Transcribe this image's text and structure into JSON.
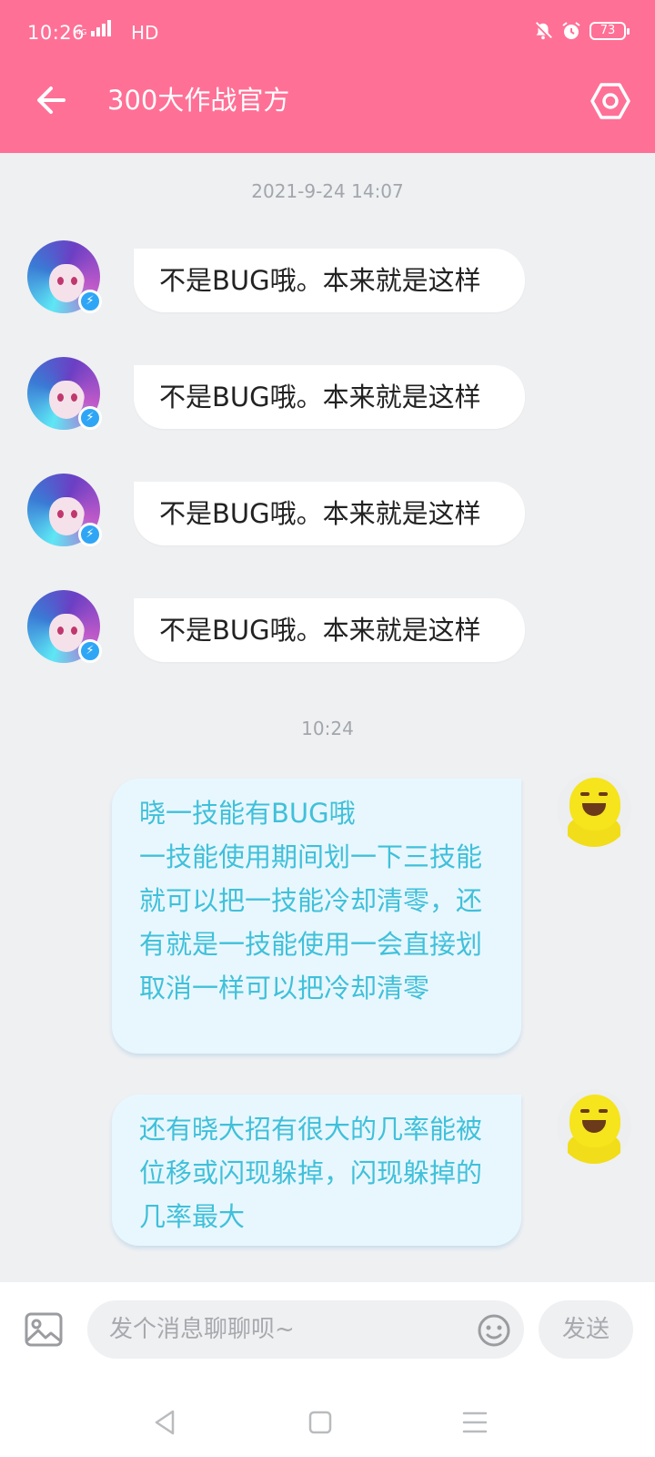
{
  "status_bar": {
    "time": "10:26",
    "network": "4G",
    "hd": "HD",
    "battery": "73"
  },
  "header": {
    "title": "300大作战官方",
    "back_icon": "arrow-left-icon",
    "settings_icon": "settings-icon"
  },
  "conversation": {
    "timestamps": [
      "2021-9-24 14:07",
      "10:24"
    ],
    "incoming": [
      {
        "text": "不是BUG哦。本来就是这样"
      },
      {
        "text": "不是BUG哦。本来就是这样"
      },
      {
        "text": "不是BUG哦。本来就是这样"
      },
      {
        "text": "不是BUG哦。本来就是这样"
      }
    ],
    "outgoing": [
      {
        "text": "晓一技能有BUG哦\n一技能使用期间划一下三技能就可以把一技能冷却清零，还有就是一技能使用一会直接划取消一样可以把冷却清零"
      },
      {
        "text": "还有晓大招有很大的几率能被位移或闪现躲掉，闪现躲掉的几率最大"
      }
    ]
  },
  "input_bar": {
    "placeholder": "发个消息聊聊呗~",
    "send_label": "发送",
    "image_icon": "image-icon",
    "emoji_icon": "emoji-icon"
  },
  "colors": {
    "header": "#ff7096",
    "outgoing_bubble": "#e8f7fd",
    "outgoing_text": "#40c0da",
    "background": "#eff0f2"
  }
}
